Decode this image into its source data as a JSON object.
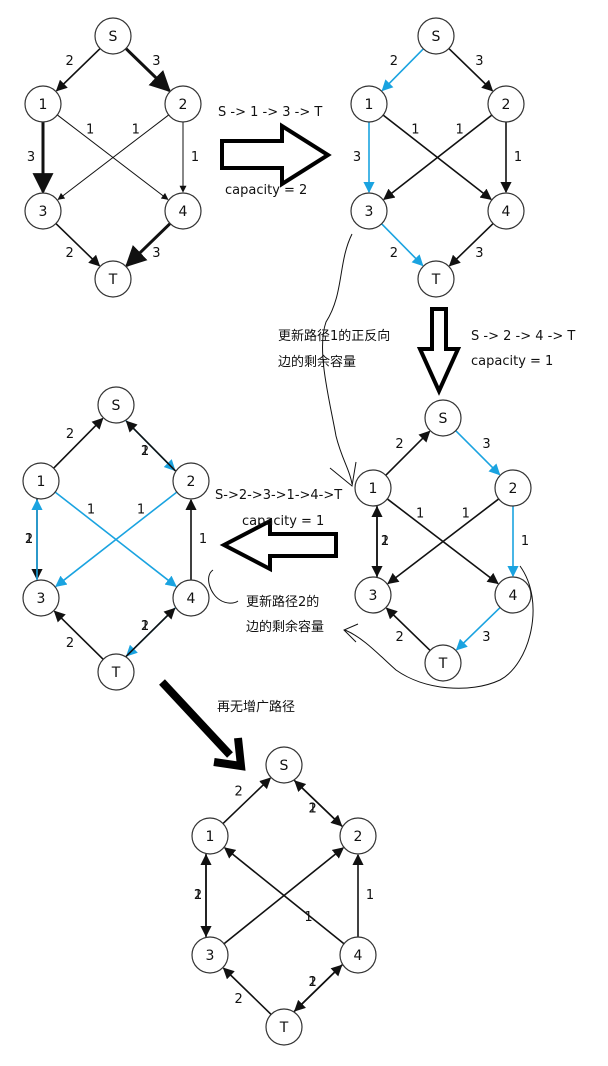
{
  "nodes": {
    "S": "S",
    "n1": "1",
    "n2": "2",
    "n3": "3",
    "n4": "4",
    "T": "T"
  },
  "colors": {
    "black": "#111111",
    "blue": "#1aa3e0"
  },
  "panels": [
    {
      "id": "original",
      "edges": [
        {
          "from": "S",
          "to": "n1",
          "label": "2",
          "color": "black",
          "weight": "normal"
        },
        {
          "from": "S",
          "to": "n2",
          "label": "3",
          "color": "black",
          "weight": "bold"
        },
        {
          "from": "n1",
          "to": "n3",
          "label": "3",
          "color": "black",
          "weight": "bold"
        },
        {
          "from": "n1",
          "to": "n4",
          "label": "1",
          "color": "black",
          "weight": "thin"
        },
        {
          "from": "n2",
          "to": "n3",
          "label": "1",
          "color": "black",
          "weight": "thin"
        },
        {
          "from": "n2",
          "to": "n4",
          "label": "1",
          "color": "black",
          "weight": "thin"
        },
        {
          "from": "n3",
          "to": "T",
          "label": "2",
          "color": "black",
          "weight": "normal"
        },
        {
          "from": "n4",
          "to": "T",
          "label": "3",
          "color": "black",
          "weight": "bold"
        }
      ]
    },
    {
      "id": "path1",
      "edges": [
        {
          "from": "S",
          "to": "n1",
          "label": "2",
          "color": "blue",
          "weight": "normal"
        },
        {
          "from": "S",
          "to": "n2",
          "label": "3",
          "color": "black",
          "weight": "normal"
        },
        {
          "from": "n1",
          "to": "n3",
          "label": "3",
          "color": "blue",
          "weight": "normal"
        },
        {
          "from": "n1",
          "to": "n4",
          "label": "1",
          "color": "black",
          "weight": "normal"
        },
        {
          "from": "n2",
          "to": "n3",
          "label": "1",
          "color": "black",
          "weight": "normal"
        },
        {
          "from": "n2",
          "to": "n4",
          "label": "1",
          "color": "black",
          "weight": "normal"
        },
        {
          "from": "n3",
          "to": "T",
          "label": "2",
          "color": "blue",
          "weight": "normal"
        },
        {
          "from": "n4",
          "to": "T",
          "label": "3",
          "color": "black",
          "weight": "normal"
        }
      ]
    },
    {
      "id": "after1",
      "edges": [
        {
          "from": "n1",
          "to": "S",
          "label": "2",
          "color": "black",
          "weight": "normal"
        },
        {
          "from": "S",
          "to": "n2",
          "label": "3",
          "color": "blue",
          "weight": "normal"
        },
        {
          "from": "n1",
          "to": "n3",
          "label": "1",
          "color": "black",
          "weight": "normal",
          "offset": -4
        },
        {
          "from": "n3",
          "to": "n1",
          "label": "2",
          "color": "black",
          "weight": "normal",
          "offset": 4
        },
        {
          "from": "n1",
          "to": "n4",
          "label": "1",
          "color": "black",
          "weight": "normal"
        },
        {
          "from": "n2",
          "to": "n3",
          "label": "1",
          "color": "black",
          "weight": "normal"
        },
        {
          "from": "n2",
          "to": "n4",
          "label": "1",
          "color": "blue",
          "weight": "normal"
        },
        {
          "from": "T",
          "to": "n3",
          "label": "2",
          "color": "black",
          "weight": "normal"
        },
        {
          "from": "n4",
          "to": "T",
          "label": "3",
          "color": "blue",
          "weight": "normal"
        }
      ]
    },
    {
      "id": "path2",
      "edges": [
        {
          "from": "n1",
          "to": "S",
          "label": "2",
          "color": "black",
          "weight": "normal"
        },
        {
          "from": "S",
          "to": "n2",
          "label": "2",
          "color": "blue",
          "weight": "normal",
          "offset": 4
        },
        {
          "from": "n2",
          "to": "S",
          "label": "1",
          "color": "black",
          "weight": "normal",
          "offset": -4
        },
        {
          "from": "n1",
          "to": "n3",
          "label": "1",
          "color": "black",
          "weight": "normal",
          "offset": 4
        },
        {
          "from": "n3",
          "to": "n1",
          "label": "2",
          "color": "blue",
          "weight": "normal",
          "offset": -4
        },
        {
          "from": "n1",
          "to": "n4",
          "label": "1",
          "color": "blue",
          "weight": "normal"
        },
        {
          "from": "n2",
          "to": "n3",
          "label": "1",
          "color": "blue",
          "weight": "normal"
        },
        {
          "from": "n4",
          "to": "n2",
          "label": "1",
          "color": "black",
          "weight": "normal"
        },
        {
          "from": "T",
          "to": "n3",
          "label": "2",
          "color": "black",
          "weight": "normal"
        },
        {
          "from": "n4",
          "to": "T",
          "label": "2",
          "color": "blue",
          "weight": "normal",
          "offset": 4
        },
        {
          "from": "T",
          "to": "n4",
          "label": "1",
          "color": "black",
          "weight": "normal",
          "offset": -4
        }
      ]
    },
    {
      "id": "final",
      "edges": [
        {
          "from": "n1",
          "to": "S",
          "label": "2",
          "color": "black",
          "weight": "normal"
        },
        {
          "from": "S",
          "to": "n2",
          "label": "1",
          "color": "black",
          "weight": "normal",
          "offset": 4
        },
        {
          "from": "n2",
          "to": "S",
          "label": "2",
          "color": "black",
          "weight": "normal",
          "offset": -4
        },
        {
          "from": "n3",
          "to": "n1",
          "label": "1",
          "color": "black",
          "weight": "normal",
          "offset": -4
        },
        {
          "from": "n1",
          "to": "n3",
          "label": "2",
          "color": "black",
          "weight": "normal",
          "offset": 4
        },
        {
          "from": "n4",
          "to": "n1",
          "label": "1",
          "color": "black",
          "weight": "normal"
        },
        {
          "from": "n3",
          "to": "n2",
          "label": "",
          "color": "black",
          "weight": "normal"
        },
        {
          "from": "n4",
          "to": "n2",
          "label": "1",
          "color": "black",
          "weight": "normal"
        },
        {
          "from": "T",
          "to": "n3",
          "label": "2",
          "color": "black",
          "weight": "normal"
        },
        {
          "from": "n4",
          "to": "T",
          "label": "1",
          "color": "black",
          "weight": "normal",
          "offset": 4
        },
        {
          "from": "T",
          "to": "n4",
          "label": "2",
          "color": "black",
          "weight": "normal",
          "offset": -4
        }
      ]
    }
  ],
  "annotations": {
    "path1_route": "S -> 1 -> 3 -> T",
    "path1_capacity": "capacity = 2",
    "path2_route": "S -> 2 -> 4 -> T",
    "path2_capacity": "capacity = 1",
    "path3_route": "S->2->3->1->4->T",
    "path3_capacity": "capacity = 1",
    "note1_line1": "更新路径1的正反向",
    "note1_line2": "边的剩余容量",
    "note2_line1": "更新路径2的",
    "note2_line2": "边的剩余容量",
    "note3": "再无增广路径"
  }
}
